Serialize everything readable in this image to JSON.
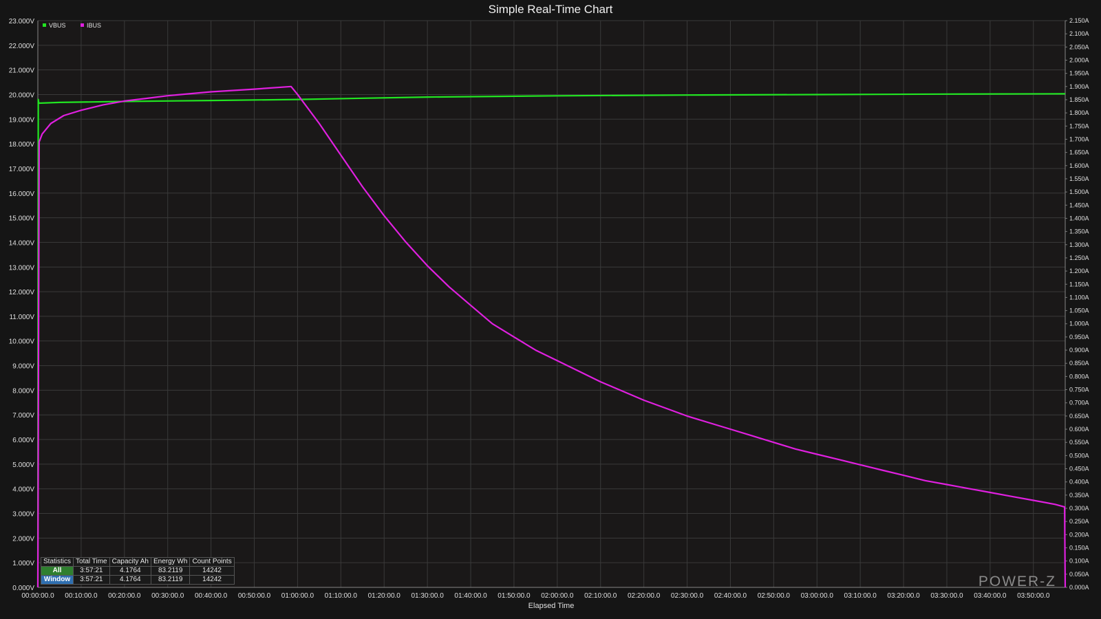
{
  "title": "Simple Real-Time Chart",
  "x_axis_label": "Elapsed Time",
  "watermark": "POWER-Z",
  "colors": {
    "vbus": "#22e622",
    "ibus": "#e020e0",
    "background": "#151515",
    "plot_bg": "#1a1818",
    "grid": "#3a3a3a"
  },
  "legend": [
    {
      "label": "VBUS",
      "color": "#22e622"
    },
    {
      "label": "IBUS",
      "color": "#e020e0"
    }
  ],
  "stats": {
    "headers": [
      "Statistics",
      "Total Time",
      "Capacity Ah",
      "Energy Wh",
      "Count Points"
    ],
    "rows": [
      {
        "label": "All",
        "total_time": "3:57:21",
        "capacity": "4.1764",
        "energy": "83.2119",
        "count": "14242"
      },
      {
        "label": "Window",
        "total_time": "3:57:21",
        "capacity": "4.1764",
        "energy": "83.2119",
        "count": "14242"
      }
    ]
  },
  "chart_data": {
    "type": "line",
    "title": "Simple Real-Time Chart",
    "xlabel": "Elapsed Time",
    "ylabel": "",
    "y2label": "",
    "x_unit": "minutes",
    "xlim": [
      0,
      237.35
    ],
    "ylim": [
      0,
      23
    ],
    "y2lim": [
      0,
      2.15
    ],
    "x_ticks": [
      "00:00:00.0",
      "00:10:00.0",
      "00:20:00.0",
      "00:30:00.0",
      "00:40:00.0",
      "00:50:00.0",
      "01:00:00.0",
      "01:10:00.0",
      "01:20:00.0",
      "01:30:00.0",
      "01:40:00.0",
      "01:50:00.0",
      "02:00:00.0",
      "02:10:00.0",
      "02:20:00.0",
      "02:30:00.0",
      "02:40:00.0",
      "02:50:00.0",
      "03:00:00.0",
      "03:10:00.0",
      "03:20:00.0",
      "03:30:00.0",
      "03:40:00.0",
      "03:50:00.0"
    ],
    "y_ticks": [
      "0.000V",
      "1.000V",
      "2.000V",
      "3.000V",
      "4.000V",
      "5.000V",
      "6.000V",
      "7.000V",
      "8.000V",
      "9.000V",
      "10.000V",
      "11.000V",
      "12.000V",
      "13.000V",
      "14.000V",
      "15.000V",
      "16.000V",
      "17.000V",
      "18.000V",
      "19.000V",
      "20.000V",
      "21.000V",
      "22.000V",
      "23.000V"
    ],
    "y2_ticks": [
      "0.000A",
      "0.050A",
      "0.100A",
      "0.150A",
      "0.200A",
      "0.250A",
      "0.300A",
      "0.350A",
      "0.400A",
      "0.450A",
      "0.500A",
      "0.550A",
      "0.600A",
      "0.650A",
      "0.700A",
      "0.750A",
      "0.800A",
      "0.850A",
      "0.900A",
      "0.950A",
      "1.000A",
      "1.050A",
      "1.100A",
      "1.150A",
      "1.200A",
      "1.250A",
      "1.300A",
      "1.350A",
      "1.400A",
      "1.450A",
      "1.500A",
      "1.550A",
      "1.600A",
      "1.650A",
      "1.700A",
      "1.750A",
      "1.800A",
      "1.850A",
      "1.900A",
      "1.950A",
      "2.000A",
      "2.050A",
      "2.100A",
      "2.150A"
    ],
    "grid": true,
    "legend_position": "top-left",
    "series": [
      {
        "name": "VBUS",
        "axis": "left",
        "x": [
          0,
          0.1,
          0.2,
          5,
          20,
          40,
          60,
          90,
          120,
          150,
          180,
          210,
          237.35
        ],
        "y": [
          0,
          19.8,
          19.65,
          19.68,
          19.72,
          19.76,
          19.8,
          19.9,
          19.95,
          19.98,
          20.0,
          20.02,
          20.03
        ]
      },
      {
        "name": "IBUS",
        "axis": "right",
        "x": [
          0,
          0.3,
          1,
          3,
          6,
          10,
          15,
          20,
          25,
          30,
          40,
          50,
          58.5,
          60,
          65,
          70,
          75,
          80,
          85,
          90,
          95,
          100,
          105,
          110,
          115,
          120,
          125,
          130,
          135,
          140,
          145,
          150,
          155,
          160,
          165,
          170,
          175,
          180,
          185,
          190,
          195,
          200,
          205,
          210,
          215,
          220,
          225,
          230,
          235,
          237.2,
          237.35
        ],
        "y": [
          0,
          1.69,
          1.72,
          1.76,
          1.79,
          1.81,
          1.83,
          1.845,
          1.855,
          1.865,
          1.88,
          1.89,
          1.9,
          1.87,
          1.76,
          1.64,
          1.52,
          1.41,
          1.31,
          1.22,
          1.14,
          1.07,
          1.0,
          0.95,
          0.9,
          0.86,
          0.82,
          0.78,
          0.745,
          0.71,
          0.68,
          0.65,
          0.625,
          0.6,
          0.575,
          0.55,
          0.525,
          0.505,
          0.485,
          0.465,
          0.445,
          0.425,
          0.405,
          0.39,
          0.375,
          0.36,
          0.345,
          0.33,
          0.315,
          0.305,
          0
        ]
      }
    ]
  }
}
